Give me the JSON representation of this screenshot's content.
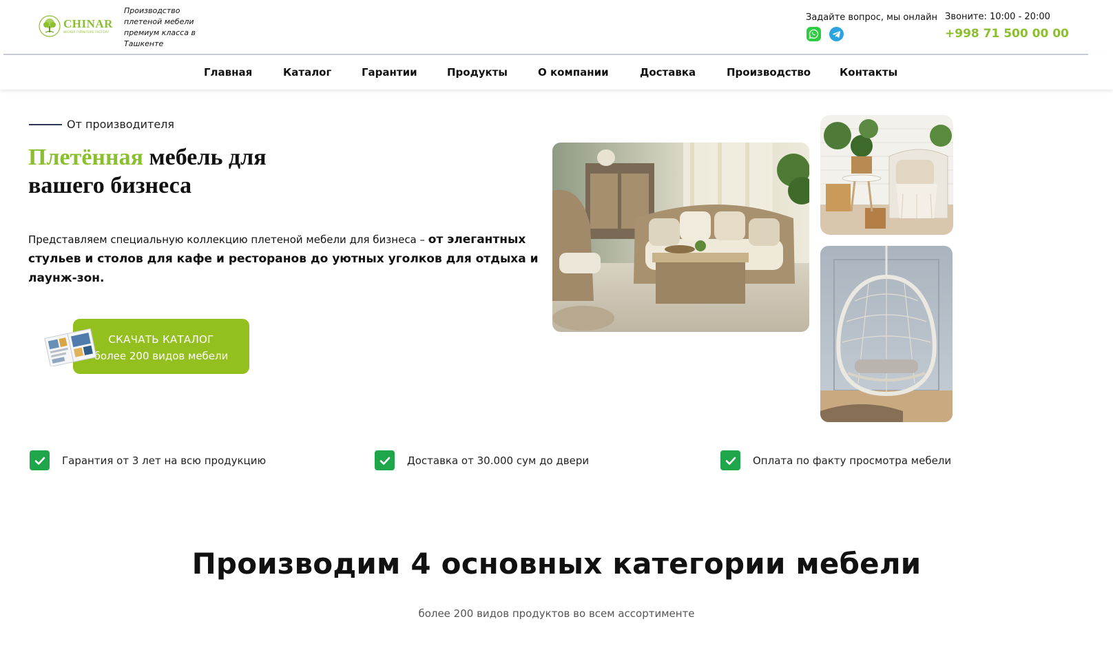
{
  "header": {
    "logo": {
      "name": "CHINAR",
      "subtitle": "WICKER FURNITURE FACTORY"
    },
    "tagline": "Производство плетеной мебели премиум класса в Ташкенте",
    "ask_question": "Задайте вопрос, мы онлайн",
    "messengers": [
      {
        "icon": "whatsapp-icon",
        "color": "#2ecc40"
      },
      {
        "icon": "telegram-icon",
        "color": "#2aa3e0"
      }
    ],
    "hours": "Звоните: 10:00 - 20:00",
    "phone": "+998 71 500 00 00"
  },
  "nav": {
    "items": [
      {
        "label": "Главная"
      },
      {
        "label": "Каталог"
      },
      {
        "label": "Гарантии"
      },
      {
        "label": "Продукты"
      },
      {
        "label": "О компании"
      },
      {
        "label": "Доставка"
      },
      {
        "label": "Производство"
      },
      {
        "label": "Контакты"
      }
    ]
  },
  "hero": {
    "eyebrow": "От производителя",
    "title_accent": "Плетённая",
    "title_rest": " мебель для вашего бизнеса",
    "desc_regular": "Представляем специальную коллекцию плетеной мебели для бизнеса – ",
    "desc_bold": "от элегантных стульев и столов для кафе и ресторанов до уютных уголков для отдыха и лаунж-зон.",
    "cta_line1": "СКАЧАТЬ КАТАЛОГ",
    "cta_line2": "более 200 видов мебели"
  },
  "features": [
    {
      "text": "Гарантия от 3 лет на всю продукцию"
    },
    {
      "text": "Доставка от 30.000 сум до двери"
    },
    {
      "text": "Оплата по факту просмотра мебели"
    }
  ],
  "section": {
    "title": "Производим 4 основных категории мебели",
    "subtitle": "более 200 видов продуктов во всем ассортименте"
  },
  "colors": {
    "accent": "#8cbf2f",
    "cta": "#93c01f",
    "check": "#1fa64a"
  }
}
